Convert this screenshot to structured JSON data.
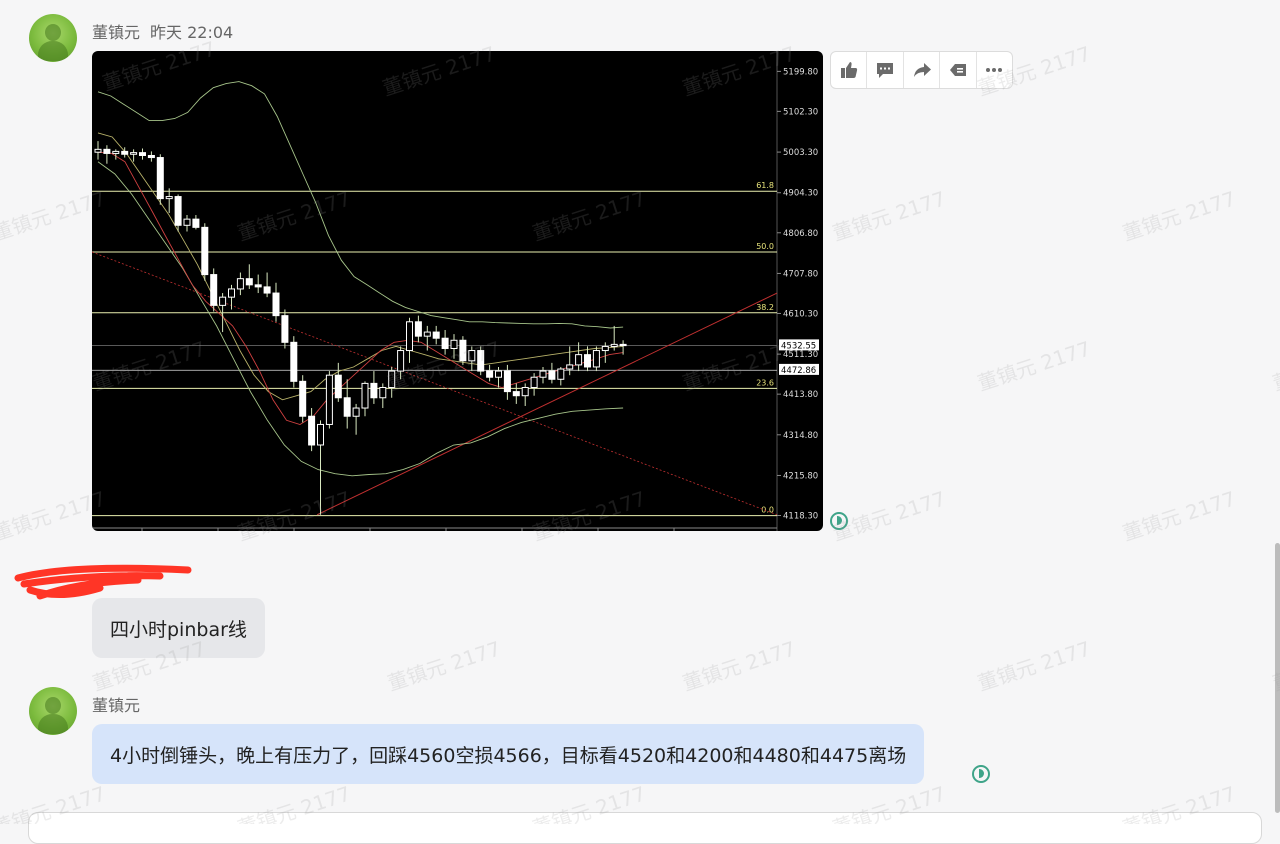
{
  "messages": [
    {
      "sender": "董镇元",
      "time": "昨天 22:04",
      "type": "image"
    },
    {
      "type": "text",
      "text": "四小时pinbar线"
    },
    {
      "sender": "董镇元",
      "type": "text",
      "text": "4小时倒锤头，晚上有压力了，回踩4560空损4566，目标看4520和4200和4480和4475离场"
    }
  ],
  "watermark_text": "董镇元 2177",
  "action_icons": [
    "thumbs-up-icon",
    "comment-icon",
    "forward-icon",
    "quote-icon",
    "more-icon"
  ],
  "chart_data": {
    "type": "candlestick",
    "y_ticks": [
      "5199.80",
      "5102.30",
      "5003.30",
      "4904.30",
      "4806.80",
      "4707.80",
      "4610.30",
      "4511.30",
      "4413.80",
      "4314.80",
      "4215.80",
      "4118.30"
    ],
    "fib_levels": [
      {
        "label": "61.8"
      },
      {
        "label": "50.0"
      },
      {
        "label": "38.2"
      },
      {
        "label": "23.6"
      },
      {
        "label": "0.0"
      }
    ],
    "price_tags": [
      "4532.55",
      "4472.86"
    ],
    "ylim": [
      4100,
      5230
    ],
    "ohlc": [
      [
        5003,
        5030,
        4985,
        5010
      ],
      [
        5010,
        5020,
        4975,
        5000
      ],
      [
        5000,
        5010,
        4985,
        5005
      ],
      [
        5005,
        5015,
        4990,
        4998
      ],
      [
        4998,
        5010,
        4980,
        5002
      ],
      [
        5002,
        5012,
        4985,
        4995
      ],
      [
        4995,
        5005,
        4980,
        4990
      ],
      [
        4990,
        4998,
        4875,
        4890
      ],
      [
        4890,
        4915,
        4855,
        4895
      ],
      [
        4895,
        4900,
        4810,
        4825
      ],
      [
        4825,
        4850,
        4810,
        4840
      ],
      [
        4840,
        4850,
        4815,
        4820
      ],
      [
        4820,
        4830,
        4690,
        4705
      ],
      [
        4705,
        4720,
        4615,
        4630
      ],
      [
        4630,
        4660,
        4565,
        4650
      ],
      [
        4650,
        4680,
        4620,
        4670
      ],
      [
        4670,
        4710,
        4655,
        4695
      ],
      [
        4695,
        4730,
        4670,
        4680
      ],
      [
        4680,
        4705,
        4660,
        4675
      ],
      [
        4675,
        4710,
        4650,
        4660
      ],
      [
        4660,
        4685,
        4590,
        4605
      ],
      [
        4605,
        4620,
        4525,
        4540
      ],
      [
        4540,
        4555,
        4430,
        4445
      ],
      [
        4445,
        4460,
        4345,
        4360
      ],
      [
        4360,
        4380,
        4275,
        4290
      ],
      [
        4290,
        4350,
        4120,
        4340
      ],
      [
        4340,
        4470,
        4330,
        4460
      ],
      [
        4460,
        4490,
        4395,
        4405
      ],
      [
        4405,
        4450,
        4330,
        4360
      ],
      [
        4360,
        4390,
        4315,
        4380
      ],
      [
        4380,
        4445,
        4360,
        4440
      ],
      [
        4440,
        4470,
        4390,
        4405
      ],
      [
        4405,
        4440,
        4380,
        4430
      ],
      [
        4430,
        4480,
        4405,
        4470
      ],
      [
        4470,
        4530,
        4450,
        4520
      ],
      [
        4520,
        4600,
        4490,
        4590
      ],
      [
        4590,
        4605,
        4540,
        4555
      ],
      [
        4555,
        4580,
        4520,
        4565
      ],
      [
        4565,
        4580,
        4535,
        4550
      ],
      [
        4550,
        4570,
        4510,
        4525
      ],
      [
        4525,
        4560,
        4500,
        4545
      ],
      [
        4545,
        4555,
        4485,
        4495
      ],
      [
        4495,
        4530,
        4470,
        4520
      ],
      [
        4520,
        4530,
        4460,
        4470
      ],
      [
        4470,
        4485,
        4445,
        4455
      ],
      [
        4455,
        4480,
        4430,
        4470
      ],
      [
        4470,
        4485,
        4400,
        4420
      ],
      [
        4420,
        4440,
        4390,
        4410
      ],
      [
        4410,
        4440,
        4385,
        4430
      ],
      [
        4430,
        4465,
        4410,
        4455
      ],
      [
        4455,
        4480,
        4440,
        4470
      ],
      [
        4470,
        4490,
        4440,
        4450
      ],
      [
        4450,
        4480,
        4435,
        4475
      ],
      [
        4475,
        4530,
        4460,
        4485
      ],
      [
        4485,
        4540,
        4470,
        4510
      ],
      [
        4510,
        4530,
        4470,
        4480
      ],
      [
        4480,
        4530,
        4470,
        4520
      ],
      [
        4520,
        4540,
        4490,
        4530
      ],
      [
        4530,
        4580,
        4520,
        4535
      ],
      [
        4535,
        4545,
        4510,
        4532
      ]
    ],
    "upper_band": [
      5150,
      5140,
      5120,
      5100,
      5080,
      5080,
      5085,
      5100,
      5135,
      5160,
      5170,
      5175,
      5165,
      5145,
      5090,
      5020,
      4950,
      4880,
      4800,
      4740,
      4700,
      4680,
      4660,
      4640,
      4625,
      4615,
      4605,
      4600,
      4595,
      4590,
      4590,
      4588,
      4587,
      4586,
      4585,
      4585,
      4586,
      4585,
      4580,
      4578,
      4575,
      4577
    ],
    "lower_band": [
      4980,
      4950,
      4900,
      4840,
      4780,
      4720,
      4650,
      4580,
      4500,
      4420,
      4350,
      4290,
      4250,
      4230,
      4220,
      4215,
      4218,
      4220,
      4230,
      4245,
      4270,
      4290,
      4295,
      4310,
      4330,
      4345,
      4355,
      4365,
      4372,
      4375,
      4378,
      4380
    ],
    "mid_band": [
      5050,
      5040,
      5000,
      4950,
      4900,
      4850,
      4790,
      4730,
      4660,
      4590,
      4520,
      4460,
      4420,
      4400,
      4410,
      4420,
      4450,
      4470,
      4480,
      4500,
      4520,
      4530,
      4520,
      4510,
      4500,
      4495,
      4490,
      4485,
      4490,
      4495,
      4500,
      4505,
      4510,
      4515,
      4520,
      4525,
      4527,
      4530
    ],
    "fast_ma": [
      5003,
      5000,
      4980,
      4920,
      4860,
      4800,
      4740,
      4680,
      4640,
      4610,
      4580,
      4530,
      4470,
      4400,
      4350,
      4340,
      4360,
      4400,
      4430,
      4460,
      4490,
      4520,
      4540,
      4545,
      4540,
      4520,
      4500,
      4480,
      4460,
      4440,
      4430,
      4440,
      4450,
      4460,
      4470,
      4480,
      4490,
      4500,
      4510,
      4515
    ]
  }
}
